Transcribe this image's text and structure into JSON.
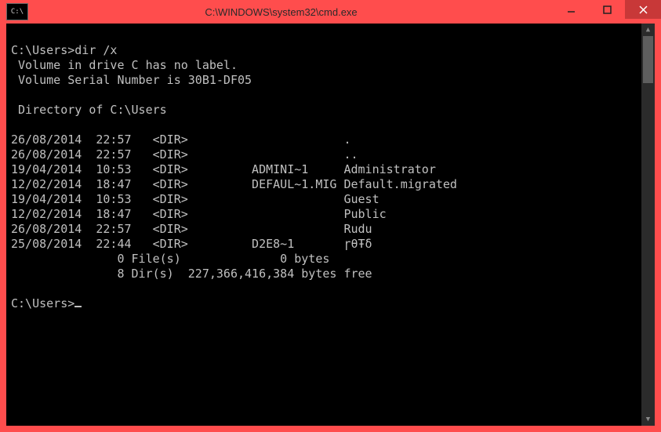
{
  "window": {
    "title": "C:\\WINDOWS\\system32\\cmd.exe",
    "app_icon_text": "C:\\"
  },
  "terminal": {
    "prompt1": "C:\\Users>",
    "command": "dir /x",
    "vol_line1": " Volume in drive C has no label.",
    "vol_line2": " Volume Serial Number is 30B1-DF05",
    "dir_of": " Directory of C:\\Users",
    "rows": [
      {
        "date": "26/08/2014",
        "time": "22:57",
        "type": "<DIR>",
        "short": "",
        "name": "."
      },
      {
        "date": "26/08/2014",
        "time": "22:57",
        "type": "<DIR>",
        "short": "",
        "name": ".."
      },
      {
        "date": "19/04/2014",
        "time": "10:53",
        "type": "<DIR>",
        "short": "ADMINI~1",
        "name": "Administrator"
      },
      {
        "date": "12/02/2014",
        "time": "18:47",
        "type": "<DIR>",
        "short": "DEFAUL~1.MIG",
        "name": "Default.migrated"
      },
      {
        "date": "19/04/2014",
        "time": "10:53",
        "type": "<DIR>",
        "short": "",
        "name": "Guest"
      },
      {
        "date": "12/02/2014",
        "time": "18:47",
        "type": "<DIR>",
        "short": "",
        "name": "Public"
      },
      {
        "date": "26/08/2014",
        "time": "22:57",
        "type": "<DIR>",
        "short": "",
        "name": "Rudu"
      },
      {
        "date": "25/08/2014",
        "time": "22:44",
        "type": "<DIR>",
        "short": "D2E8~1",
        "name": "ɼθŦδ"
      }
    ],
    "summary_files": "               0 File(s)              0 bytes",
    "summary_dirs": "               8 Dir(s)  227,366,416,384 bytes free",
    "prompt2": "C:\\Users>"
  }
}
